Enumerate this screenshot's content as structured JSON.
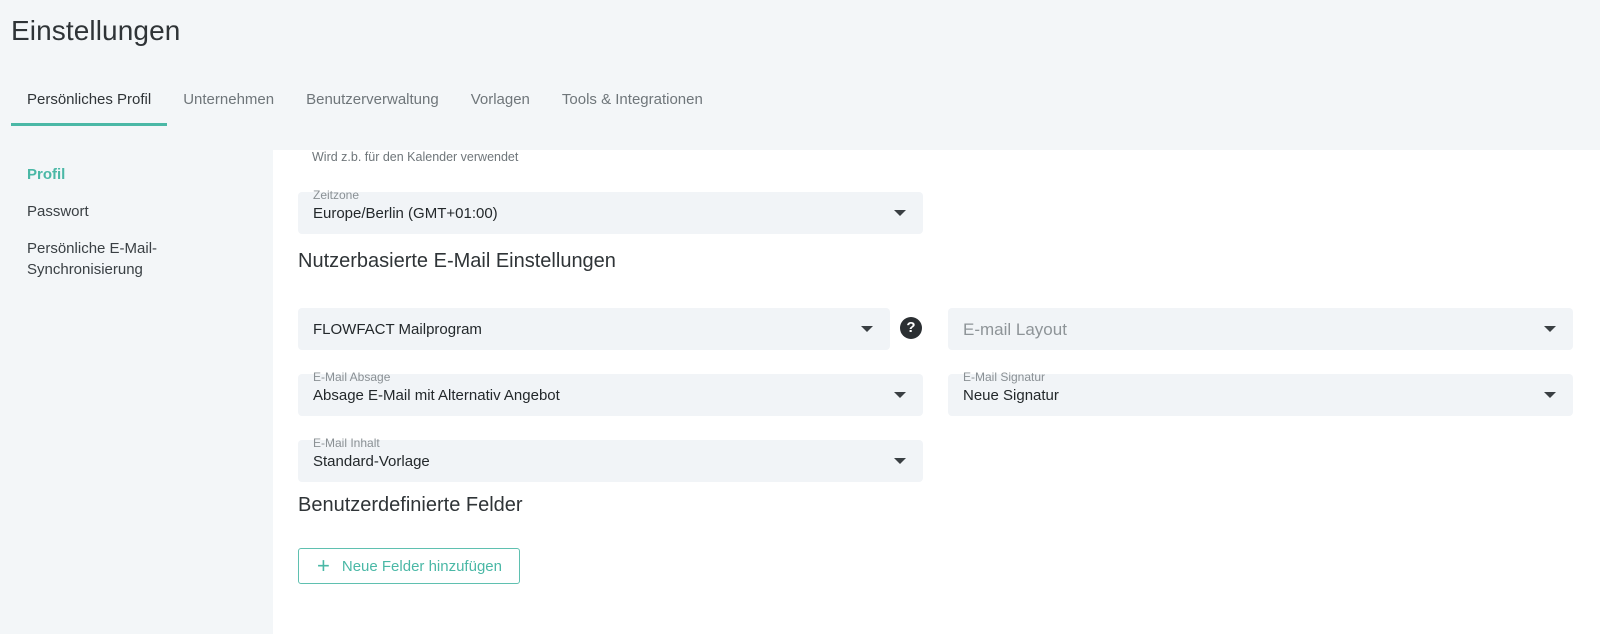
{
  "page": {
    "title": "Einstellungen"
  },
  "tabs": [
    {
      "label": "Persönliches Profil",
      "active": true
    },
    {
      "label": "Unternehmen"
    },
    {
      "label": "Benutzerverwaltung"
    },
    {
      "label": "Vorlagen"
    },
    {
      "label": "Tools & Integrationen"
    }
  ],
  "sidebar": {
    "items": [
      {
        "label": "Profil",
        "active": true
      },
      {
        "label": "Passwort"
      },
      {
        "label": "Persönliche E-Mail-\nSynchronisierung"
      }
    ],
    "item3_line1": "Persönliche E-Mail-",
    "item3_line2": "Synchronisierung"
  },
  "form": {
    "hint": "Wird z.b. für den Kalender verwendet",
    "timezone": {
      "label": "Zeitzone",
      "value": "Europe/Berlin (GMT+01:00)"
    },
    "email_section_title": "Nutzerbasierte E-Mail Einstellungen",
    "mail_program": {
      "value": "FLOWFACT Mailprogram"
    },
    "help_icon": "?",
    "email_layout": {
      "placeholder": "E-mail Layout"
    },
    "email_absage": {
      "label": "E-Mail Absage",
      "value": "Absage E-Mail mit Alternativ Angebot"
    },
    "email_signatur": {
      "label": "E-Mail Signatur",
      "value": "Neue Signatur"
    },
    "email_inhalt": {
      "label": "E-Mail Inhalt",
      "value": "Standard-Vorlage"
    },
    "custom_fields_title": "Benutzerdefinierte Felder",
    "add_fields_button": "Neue Felder hinzufügen",
    "add_icon": "+"
  },
  "colors": {
    "accent": "#4ab8a6",
    "background": "#f3f6f8",
    "field": "#f1f4f7"
  }
}
